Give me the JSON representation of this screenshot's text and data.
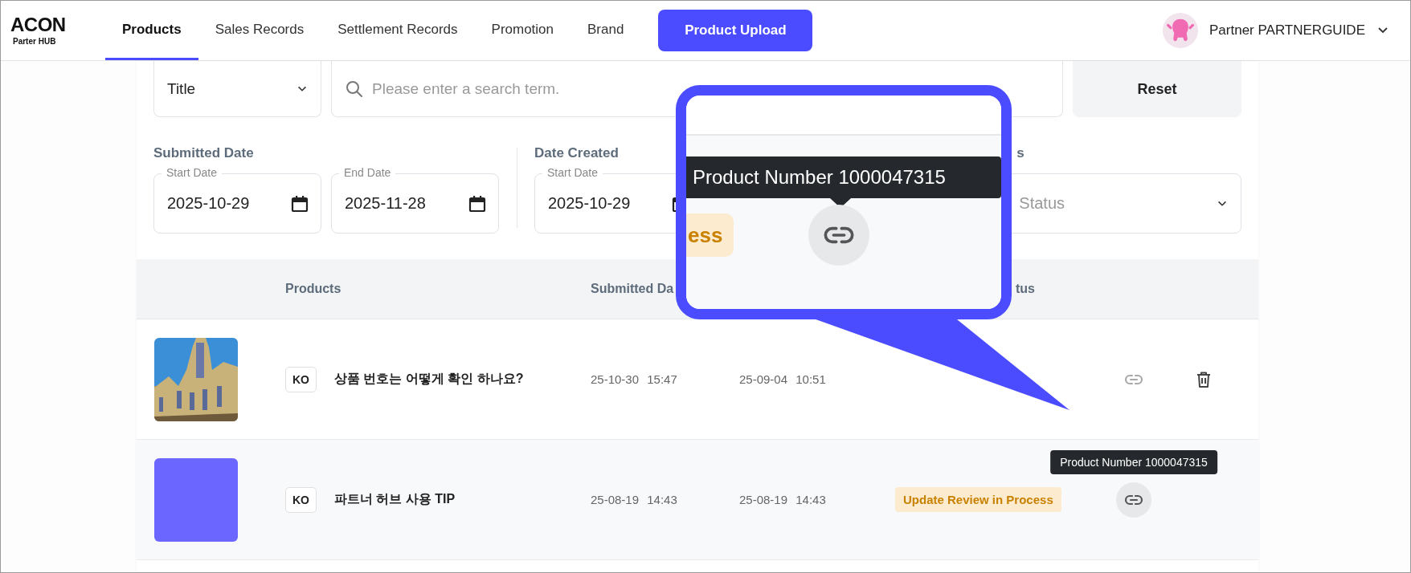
{
  "header": {
    "logo": "ACON",
    "logo_sub": "Parter HUB",
    "nav": [
      {
        "label": "Products",
        "selected": true
      },
      {
        "label": "Sales Records",
        "selected": false
      },
      {
        "label": "Settlement Records",
        "selected": false
      },
      {
        "label": "Promotion",
        "selected": false
      },
      {
        "label": "Brand",
        "selected": false
      }
    ],
    "upload_button": "Product Upload",
    "user": {
      "name": "Partner PARTNERGUIDE"
    }
  },
  "filters": {
    "search_by": {
      "value": "Title"
    },
    "search": {
      "placeholder": "Please enter a search term."
    },
    "reset_button": "Reset",
    "date_groups": [
      {
        "label": "Submitted Date",
        "fields": [
          {
            "label": "Start Date",
            "value": "2025-10-29"
          },
          {
            "label": "End Date",
            "value": "2025-11-28"
          }
        ]
      },
      {
        "label": "Date Created",
        "fields": [
          {
            "label": "Start Date",
            "value": "2025-10-29"
          }
        ]
      }
    ],
    "status_filter": {
      "label": "s",
      "placeholder": "Status"
    }
  },
  "table": {
    "columns": [
      "Products",
      "Submitted Da",
      "tus"
    ],
    "rows": [
      {
        "language": "KO",
        "title": "상품 번호는 어떻게 확인 하나요?",
        "submitted": "25-10-30 15:47",
        "created": "25-09-04 10:51",
        "link_hovered": false,
        "deletable": true
      },
      {
        "thumbnail": {
          "kind": "color",
          "color": "#6b66ff"
        },
        "language": "KO",
        "title": "파트너 허브 사용 TIP",
        "submitted": "25-08-19 14:43",
        "created": "25-08-19 14:43",
        "status": "Update Review in Process",
        "link_hovered": true,
        "deletable": false
      }
    ]
  },
  "tooltip": {
    "text": "Product Number 1000047315"
  },
  "magnifier": {
    "tooltip": "Product Number 1000047315",
    "badge_fragment": "ess"
  }
}
